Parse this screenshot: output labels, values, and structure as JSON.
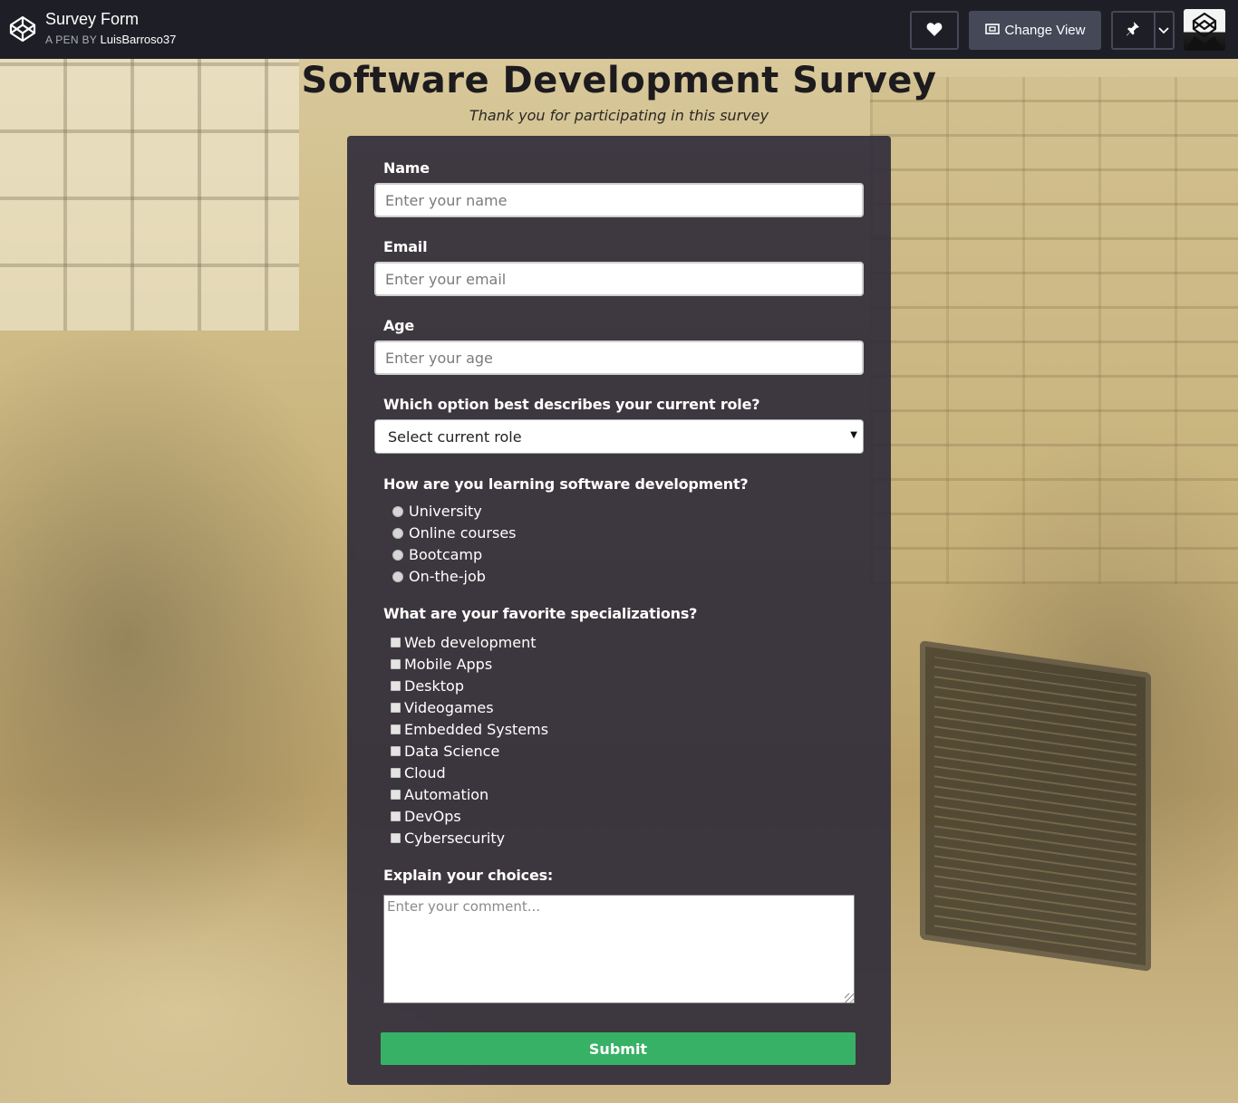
{
  "topbar": {
    "title": "Survey Form",
    "by_prefix": "A PEN BY ",
    "author": "LuisBarroso37",
    "change_view_label": "Change View",
    "icons": {
      "logo": "codepen-logo-icon",
      "heart": "heart-icon",
      "change_view": "change-view-icon",
      "pin": "pin-icon",
      "caret": "chevron-down-icon"
    }
  },
  "page": {
    "title": "Software Development Survey",
    "subtitle": "Thank you for participating in this survey"
  },
  "form": {
    "name": {
      "label": "Name",
      "placeholder": "Enter your name"
    },
    "email": {
      "label": "Email",
      "placeholder": "Enter your email"
    },
    "age": {
      "label": "Age",
      "placeholder": "Enter your age"
    },
    "role": {
      "label": "Which option best describes your current role?",
      "selected": "Select current role"
    },
    "learning": {
      "label": "How are you learning software development?",
      "options": [
        "University",
        "Online courses",
        "Bootcamp",
        "On-the-job"
      ]
    },
    "specializations": {
      "label": "What are your favorite specializations?",
      "options": [
        "Web development",
        "Mobile Apps",
        "Desktop",
        "Videogames",
        "Embedded Systems",
        "Data Science",
        "Cloud",
        "Automation",
        "DevOps",
        "Cybersecurity"
      ]
    },
    "comment": {
      "label": "Explain your choices:",
      "placeholder": "Enter your comment..."
    },
    "submit_label": "Submit"
  },
  "colors": {
    "topbar_bg": "#1e1f26",
    "card_bg": "#2e2a38",
    "submit_bg": "#37b166"
  }
}
